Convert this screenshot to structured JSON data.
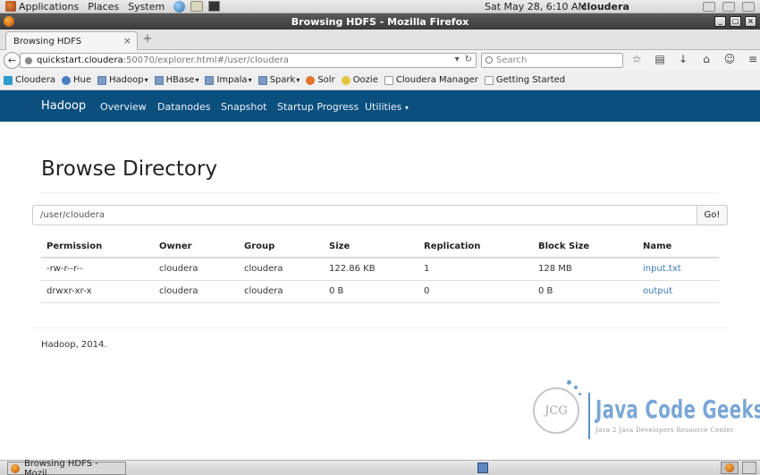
{
  "top_panel": {
    "applications": "Applications",
    "places": "Places",
    "system": "System",
    "datetime": "Sat May 28,  6:10 AM",
    "user": "cloudera"
  },
  "window": {
    "title": "Browsing HDFS - Mozilla Firefox"
  },
  "browser": {
    "tab_title": "Browsing HDFS",
    "url_host": "quickstart.cloudera",
    "url_rest": ":50070/explorer.html#/user/cloudera",
    "search_placeholder": "Search",
    "bookmarks": [
      {
        "label": "Cloudera",
        "icon": "cloudera-icon"
      },
      {
        "label": "Hue",
        "icon": "hue-icon"
      },
      {
        "label": "Hadoop",
        "icon": "folder-icon",
        "dropdown": true
      },
      {
        "label": "HBase",
        "icon": "folder-icon",
        "dropdown": true
      },
      {
        "label": "Impala",
        "icon": "folder-icon",
        "dropdown": true
      },
      {
        "label": "Spark",
        "icon": "folder-icon",
        "dropdown": true
      },
      {
        "label": "Solr",
        "icon": "solr-icon"
      },
      {
        "label": "Oozie",
        "icon": "oozie-icon"
      },
      {
        "label": "Cloudera Manager",
        "icon": "page-icon"
      },
      {
        "label": "Getting Started",
        "icon": "page-icon"
      }
    ]
  },
  "hadoop_nav": {
    "brand": "Hadoop",
    "links": [
      "Overview",
      "Datanodes",
      "Snapshot",
      "Startup Progress",
      "Utilities"
    ],
    "color": "#0a4f7e"
  },
  "main": {
    "title": "Browse Directory",
    "path_value": "/user/cloudera",
    "go_label": "Go!",
    "columns": [
      "Permission",
      "Owner",
      "Group",
      "Size",
      "Replication",
      "Block Size",
      "Name"
    ],
    "rows": [
      [
        "-rw-r--r--",
        "cloudera",
        "cloudera",
        "122.86 KB",
        "1",
        "128 MB",
        "input.txt"
      ],
      [
        "drwxr-xr-x",
        "cloudera",
        "cloudera",
        "0 B",
        "0",
        "0 B",
        "output"
      ]
    ],
    "footer": "Hadoop, 2014."
  },
  "logo": {
    "mark": "JCG",
    "name": "Java Code Geeks",
    "tagline": "Java 2 Java Developers Resource Center"
  },
  "taskbar": {
    "task_label": "Browsing HDFS - Mozil..."
  }
}
